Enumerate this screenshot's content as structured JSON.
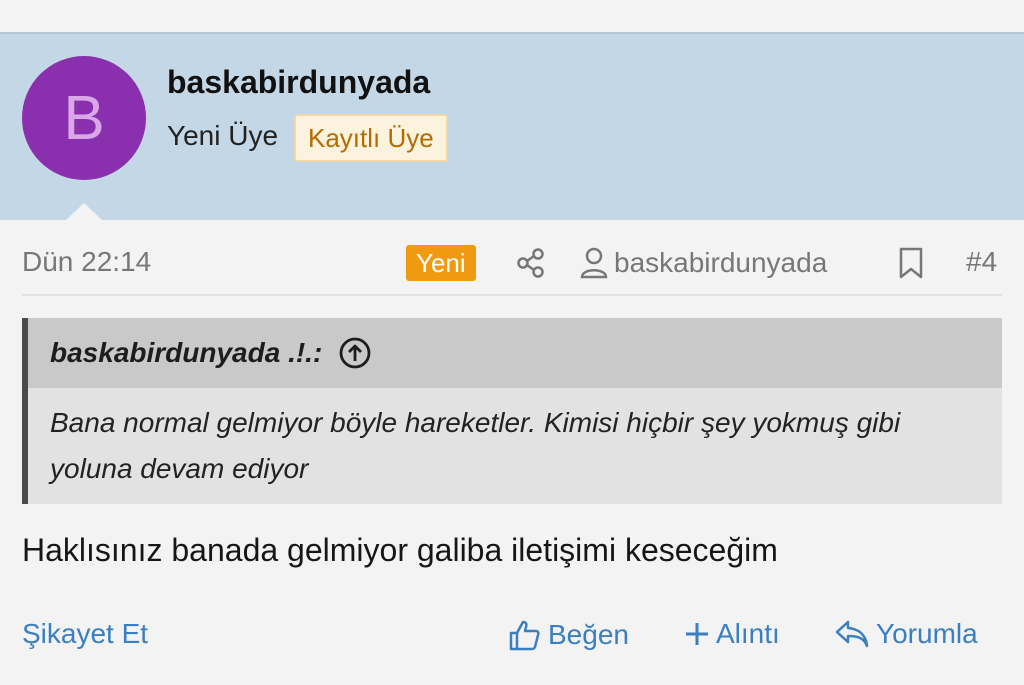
{
  "user": {
    "avatar_letter": "B",
    "name": "baskabirdunyada",
    "role": "Yeni Üye",
    "badge": "Kayıtlı Üye"
  },
  "post": {
    "time": "Dün 22:14",
    "new_label": "Yeni",
    "author": "baskabirdunyada",
    "number": "#4",
    "quote": {
      "author": "baskabirdunyada .!.:",
      "text": "Bana normal gelmiyor böyle hareketler. Kimisi hiçbir şey yokmuş gibi yoluna devam ediyor"
    },
    "body": "Haklısınız banada gelmiyor galiba iletişimi keseceğim"
  },
  "actions": {
    "report": "Şikayet Et",
    "like": "Beğen",
    "quote": "Alıntı",
    "reply": "Yorumla"
  },
  "colors": {
    "header_bg": "#c4d7e6",
    "avatar_bg": "#8a2fae",
    "new_badge": "#f09a12",
    "link": "#3a7fbf"
  },
  "icons": [
    "share-icon",
    "user-icon",
    "bookmark-icon",
    "arrow-up-circle-icon",
    "thumbs-up-icon",
    "plus-icon",
    "reply-icon"
  ]
}
